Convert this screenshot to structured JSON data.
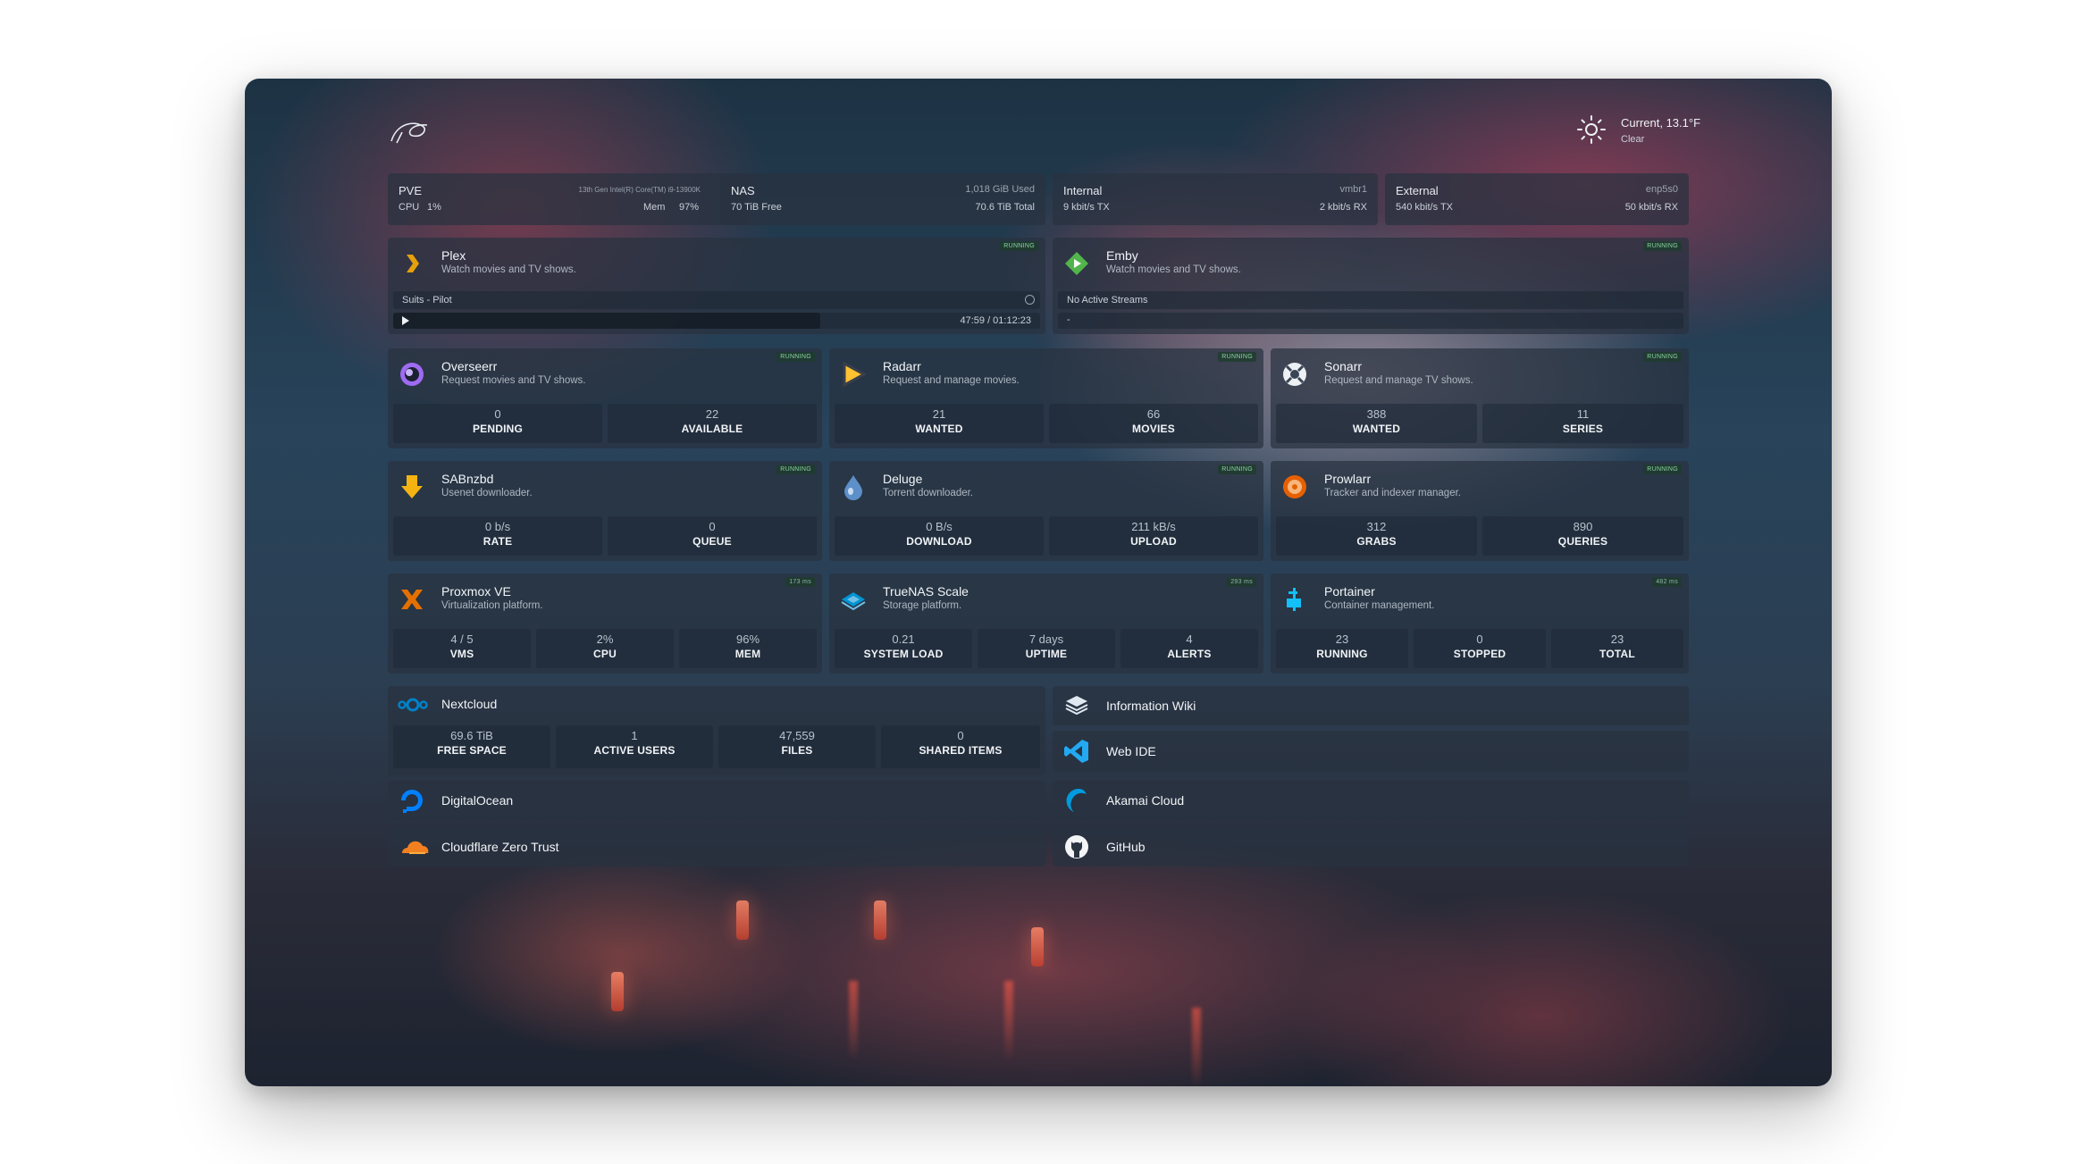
{
  "weather": {
    "current": "Current, 13.1°F",
    "condition": "Clear"
  },
  "resources": [
    {
      "title": "PVE",
      "cpu_label": "CPU",
      "cpu_value": "1%",
      "detail": "13th Gen Intel(R) Core(TM) i9-13900K",
      "mem_label": "Mem",
      "mem_value": "97%"
    },
    {
      "title": "NAS",
      "line1": "70 TiB Free",
      "right1": "1,018 GiB Used",
      "right2": "70.6 TiB Total"
    },
    {
      "title": "Internal",
      "line1": "9 kbit/s TX",
      "right1": "vmbr1",
      "right2": "2 kbit/s RX"
    },
    {
      "title": "External",
      "line1": "540 kbit/s TX",
      "right1": "enp5s0",
      "right2": "50 kbit/s RX"
    }
  ],
  "plex": {
    "name": "Plex",
    "desc": "Watch movies and TV shows.",
    "status": "RUNNING",
    "stream_title": "Suits - Pilot",
    "progress_text": "47:59 / 01:12:23",
    "progress": 0.66
  },
  "emby": {
    "name": "Emby",
    "desc": "Watch movies and TV shows.",
    "status": "RUNNING",
    "stream_text": "No Active Streams",
    "dash": "-"
  },
  "services_row1": [
    {
      "name": "Overseerr",
      "desc": "Request movies and TV shows.",
      "status": "RUNNING",
      "stats": [
        {
          "v": "0",
          "l": "PENDING"
        },
        {
          "v": "22",
          "l": "AVAILABLE"
        }
      ]
    },
    {
      "name": "Radarr",
      "desc": "Request and manage movies.",
      "status": "RUNNING",
      "stats": [
        {
          "v": "21",
          "l": "WANTED"
        },
        {
          "v": "66",
          "l": "MOVIES"
        }
      ]
    },
    {
      "name": "Sonarr",
      "desc": "Request and manage TV shows.",
      "status": "RUNNING",
      "stats": [
        {
          "v": "388",
          "l": "WANTED"
        },
        {
          "v": "11",
          "l": "SERIES"
        }
      ]
    }
  ],
  "services_row2": [
    {
      "name": "SABnzbd",
      "desc": "Usenet downloader.",
      "status": "RUNNING",
      "stats": [
        {
          "v": "0 b/s",
          "l": "RATE"
        },
        {
          "v": "0",
          "l": "QUEUE"
        }
      ]
    },
    {
      "name": "Deluge",
      "desc": "Torrent downloader.",
      "status": "RUNNING",
      "stats": [
        {
          "v": "0 B/s",
          "l": "DOWNLOAD"
        },
        {
          "v": "211 kB/s",
          "l": "UPLOAD"
        }
      ]
    },
    {
      "name": "Prowlarr",
      "desc": "Tracker and indexer manager.",
      "status": "RUNNING",
      "stats": [
        {
          "v": "312",
          "l": "GRABS"
        },
        {
          "v": "890",
          "l": "QUERIES"
        }
      ]
    }
  ],
  "services_row3": [
    {
      "name": "Proxmox VE",
      "desc": "Virtualization platform.",
      "status": "173 ms",
      "stats": [
        {
          "v": "4 / 5",
          "l": "VMS"
        },
        {
          "v": "2%",
          "l": "CPU"
        },
        {
          "v": "96%",
          "l": "MEM"
        }
      ]
    },
    {
      "name": "TrueNAS Scale",
      "desc": "Storage platform.",
      "status": "293 ms",
      "stats": [
        {
          "v": "0.21",
          "l": "SYSTEM LOAD"
        },
        {
          "v": "7 days",
          "l": "UPTIME"
        },
        {
          "v": "4",
          "l": "ALERTS"
        }
      ]
    },
    {
      "name": "Portainer",
      "desc": "Container management.",
      "status": "482 ms",
      "stats": [
        {
          "v": "23",
          "l": "RUNNING"
        },
        {
          "v": "0",
          "l": "STOPPED"
        },
        {
          "v": "23",
          "l": "TOTAL"
        }
      ]
    }
  ],
  "nextcloud": {
    "name": "Nextcloud",
    "stats": [
      {
        "v": "69.6 TiB",
        "l": "FREE SPACE"
      },
      {
        "v": "1",
        "l": "ACTIVE USERS"
      },
      {
        "v": "47,559",
        "l": "FILES"
      },
      {
        "v": "0",
        "l": "SHARED ITEMS"
      }
    ]
  },
  "bookmarks": {
    "wiki": "Information Wiki",
    "webide": "Web IDE",
    "digitalocean": "DigitalOcean",
    "akamai": "Akamai Cloud",
    "cloudflare": "Cloudflare Zero Trust",
    "github": "GitHub"
  }
}
